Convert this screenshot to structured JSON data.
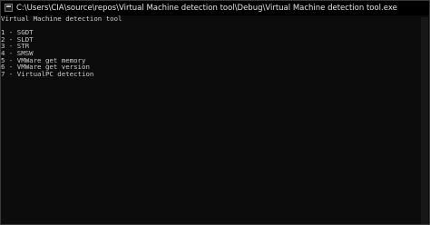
{
  "window": {
    "title": "C:\\Users\\CIA\\source\\repos\\Virtual Machine detection tool\\Debug\\Virtual Machine detection tool.exe",
    "icon": "console-app-icon"
  },
  "console": {
    "lines": [
      "Virtual Machine detection tool",
      "",
      "1 - SGDT",
      "2 - SLDT",
      "3 - STR",
      "4 - SMSW",
      "5 - VMWare get memory",
      "6 - VMWare get version",
      "7 - VirtualPC detection"
    ]
  }
}
